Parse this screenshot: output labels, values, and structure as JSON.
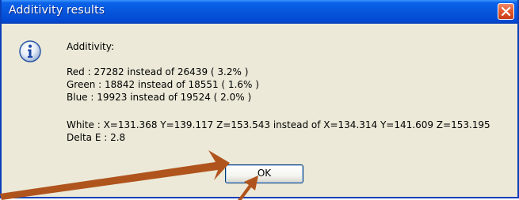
{
  "window": {
    "title": "Additivity results",
    "close_icon": "close-icon"
  },
  "dialog": {
    "icon": "info-icon",
    "heading": "Additivity:",
    "lines": {
      "red": "Red : 27282 instead of 26439 ( 3.2% )",
      "green": "Green : 18842 instead of 18551 ( 1.6% )",
      "blue": "Blue : 19923 instead of 19524 ( 2.0% )",
      "white": "White : X=131.368 Y=139.117 Z=153.543 instead of X=134.314 Y=141.609 Z=153.195",
      "delta_e": "Delta E : 2.8"
    },
    "ok_label": "OK"
  },
  "annotation": {
    "arrow_color": "#b0541d"
  }
}
